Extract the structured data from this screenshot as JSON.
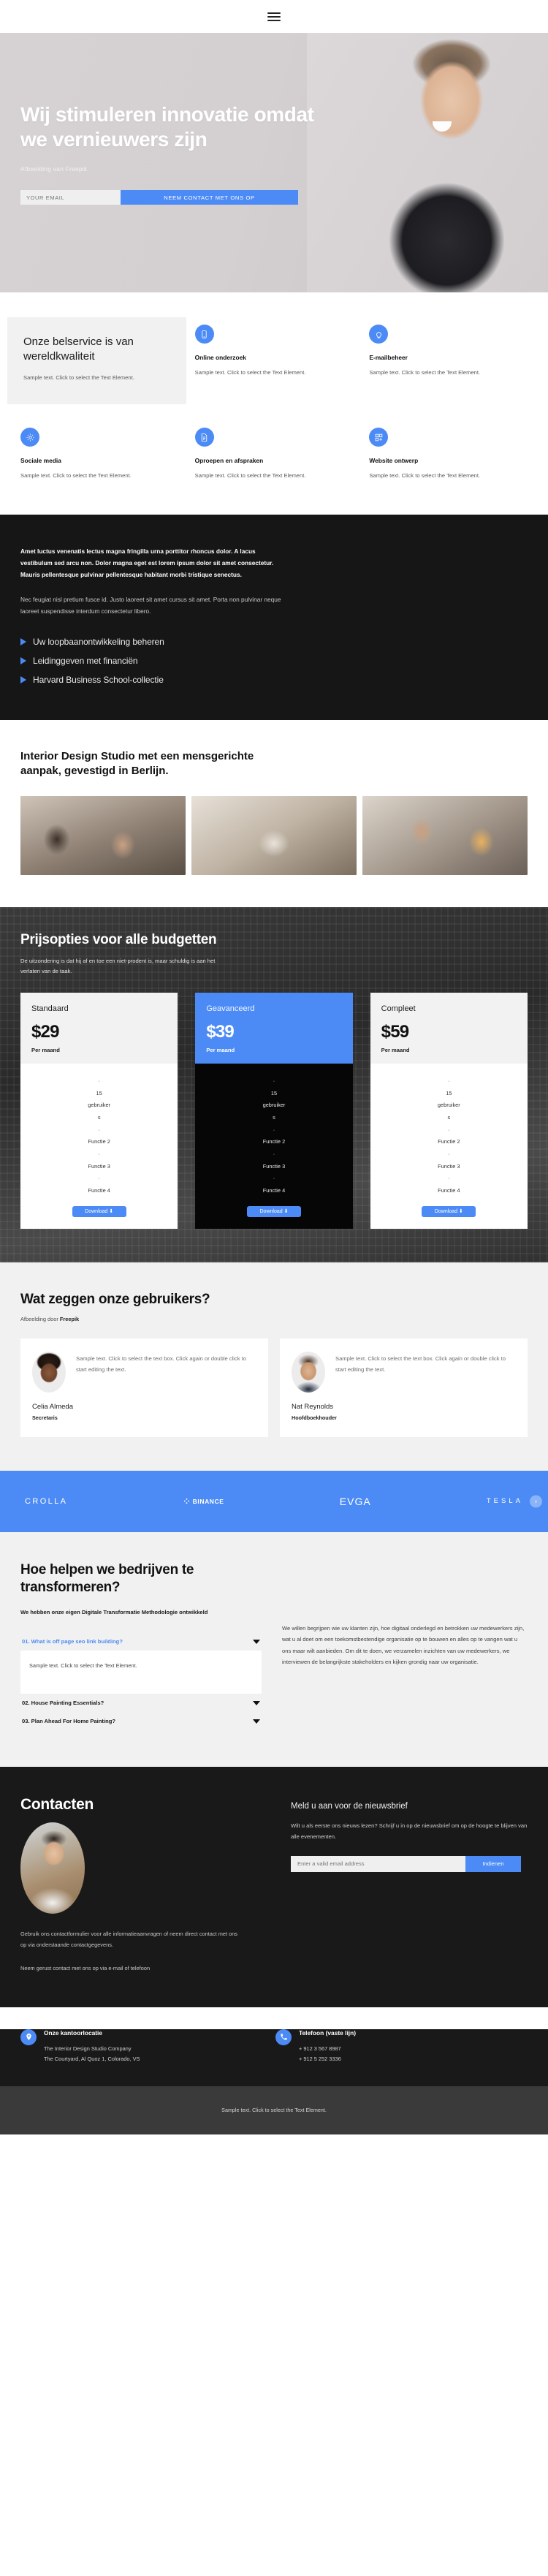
{
  "header": {
    "menu_icon": "hamburger-menu-icon"
  },
  "hero": {
    "heading": "Wij stimuleren innovatie omdat we vernieuwers zijn",
    "credit": "Afbeelding van Freepik",
    "email_placeholder": "YOUR EMAIL",
    "cta_label": "NEEM CONTACT MET ONS OP"
  },
  "services": {
    "intro_title": "Onze belservice is van wereldkwaliteit",
    "intro_text": "Sample text. Click to select the Text Element.",
    "items": [
      {
        "icon": "mobile-phone-icon",
        "title": "Online onderzoek",
        "text": "Sample text. Click to select the Text Element."
      },
      {
        "icon": "lightbulb-icon",
        "title": "E-mailbeheer",
        "text": "Sample text. Click to select the Text Element."
      },
      {
        "icon": "gear-icon",
        "title": "Sociale media",
        "text": "Sample text. Click to select the Text Element."
      },
      {
        "icon": "document-list-icon",
        "title": "Oproepen en afspraken",
        "text": "Sample text. Click to select the Text Element."
      },
      {
        "icon": "grid-plus-icon",
        "title": "Website ontwerp",
        "text": "Sample text. Click to select the Text Element."
      }
    ]
  },
  "dark_block": {
    "lead": "Amet luctus venenatis lectus magna fringilla urna porttitor rhoncus dolor. A lacus vestibulum sed arcu non. Dolor magna eget est lorem ipsum dolor sit amet consectetur. Mauris pellentesque pulvinar pellentesque habitant morbi tristique senectus.",
    "sub": "Nec feugiat nisl pretium fusce id. Justo laoreet sit amet cursus sit amet. Porta non pulvinar neque laoreet suspendisse interdum consectetur libero.",
    "links": [
      "Uw loopbaanontwikkeling beheren",
      "Leidinggeven met financiën",
      "Harvard Business School-collectie"
    ]
  },
  "studio": {
    "heading": "Interior Design Studio met een mensgerichte aanpak, gevestigd in Berlijn.",
    "images": [
      "office-team-meeting-photo",
      "tablet-workspace-photo",
      "colleagues-discussion-photo"
    ]
  },
  "pricing": {
    "heading": "Prijsopties voor alle budgetten",
    "subtitle": "De uitzondering is dat hij af en toe een niet-prodent is, maar schuldig is aan het verlaten van de taak.",
    "plans": [
      {
        "name": "Standaard",
        "price": "$29",
        "period": "Per maand",
        "features": [
          "·",
          "15",
          "gebruiker",
          "s",
          "·",
          "Functie 2",
          "·",
          "Functie 3",
          "·",
          "Functie 4"
        ],
        "button": "Download ⬇",
        "featured": false
      },
      {
        "name": "Geavanceerd",
        "price": "$39",
        "period": "Per maand",
        "features": [
          "·",
          "15",
          "gebruiker",
          "s",
          "·",
          "Functie 2",
          "·",
          "Functie 3",
          "·",
          "Functie 4"
        ],
        "button": "Download ⬇",
        "featured": true
      },
      {
        "name": "Compleet",
        "price": "$59",
        "period": "Per maand",
        "features": [
          "·",
          "15",
          "gebruiker",
          "s",
          "·",
          "Functie 2",
          "·",
          "Functie 3",
          "·",
          "Functie 4"
        ],
        "button": "Download ⬇",
        "featured": false
      }
    ]
  },
  "testimonials": {
    "heading": "Wat zeggen onze gebruikers?",
    "credit_prefix": "Afbeelding door ",
    "credit_brand": "Freepik",
    "cards": [
      {
        "quote": "Sample text. Click to select the text box. Click again or double click to start editing the text.",
        "name": "Celia Almeda",
        "role": "Secretaris",
        "avatar": "woman-portrait-avatar"
      },
      {
        "quote": "Sample text. Click to select the text box. Click again or double click to start editing the text.",
        "name": "Nat Reynolds",
        "role": "Hoofdboekhouder",
        "avatar": "man-glasses-portrait-avatar"
      }
    ]
  },
  "brands": {
    "items": [
      "CROLLA",
      "BINANCE",
      "EVGA",
      "TESLA"
    ],
    "next_icon": "chevron-right-icon",
    "accent": "#4c8bf5"
  },
  "faq": {
    "heading": "Hoe helpen we bedrijven te transformeren?",
    "strapline": "We hebben onze eigen Digitale Transformatie Methodologie ontwikkeld",
    "items": [
      {
        "question": "01. What is off page seo link building?",
        "answer": "Sample text. Click to select the Text Element.",
        "open": true
      },
      {
        "question": "02. House Painting Essentials?",
        "answer": "",
        "open": false
      },
      {
        "question": "03. Plan Ahead For Home Painting?",
        "answer": "",
        "open": false
      }
    ],
    "right_text": "We willen begrijpen wie uw klanten zijn, hoe digitaal onderlegd en betrokken uw medewerkers zijn, wat u al doet om een toekomstbestendige organisatie op te bouwen en alles op te vangen wat u ons maar wilt aanbieden. Om dit te doen, we verzamelen inzichten van uw medewerkers, we interviewen de belangrijkste stakeholders en kijken grondig naar uw organisatie."
  },
  "footer": {
    "heading": "Contacten",
    "avatar": "woman-at-laptop-photo",
    "copy": "Gebruik ons contactformulier voor alle informatieaanvragen of neem direct contact met ons op via onderstaande contactgegevens.",
    "copy2": "Neem gerust contact met ons op via e-mail of telefoon",
    "office": {
      "icon": "location-pin-icon",
      "title": "Onze kantoorlocatie",
      "line1": "The Interior Design Studio Company",
      "line2": "The Courtyard, Al Quoz 1, Colorado,  VS"
    },
    "phone": {
      "icon": "phone-icon",
      "title": "Telefoon (vaste lijn)",
      "line1": "+ 912 3 567 8987",
      "line2": "+ 912 5 252 3336"
    },
    "newsletter": {
      "title": "Meld u aan voor de nieuwsbrief",
      "text": "Wilt u als eerste ons nieuws lezen? Schrijf u in op de nieuwsbrief om op de hoogte te blijven van alle evenementen.",
      "placeholder": "Enter a valid email address",
      "button": "Indienen"
    },
    "bottom_text": "Sample text. Click to select the Text Element."
  }
}
